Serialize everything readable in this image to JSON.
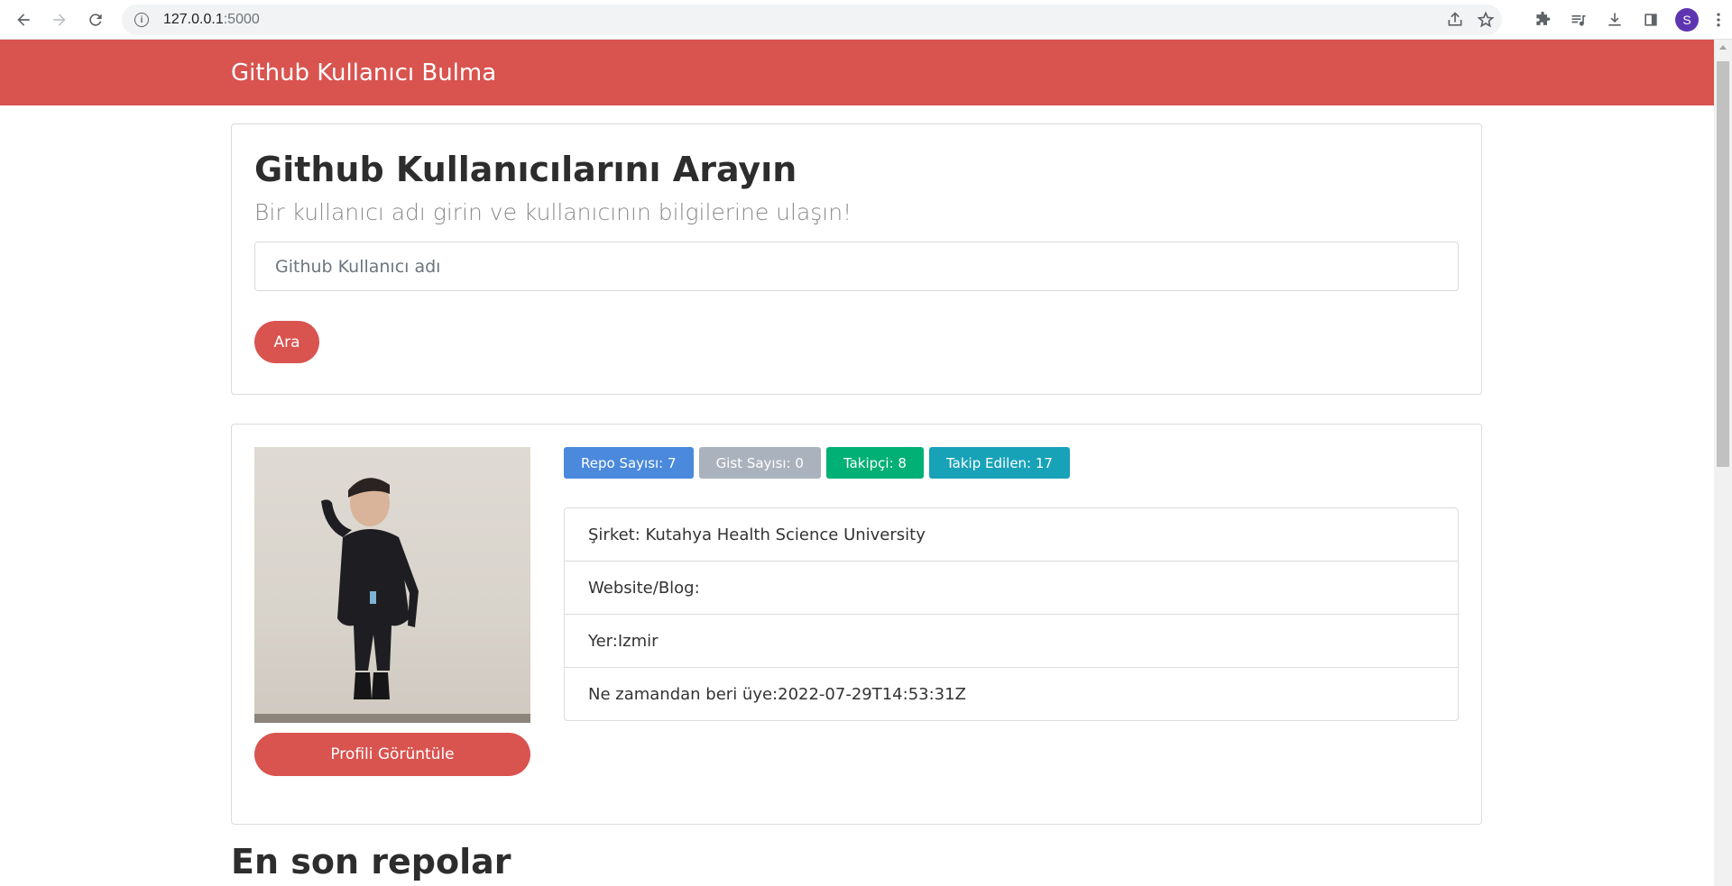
{
  "browser": {
    "url_host": "127.0.0.1",
    "url_port": ":5000",
    "profile_initial": "S"
  },
  "navbar": {
    "brand": "Github Kullanıcı Bulma"
  },
  "search": {
    "title": "Github Kullanıcılarını Arayın",
    "lead": "Bir kullanıcı adı girin ve kullanıcının bilgilerine ulaşın!",
    "input_value": "",
    "input_placeholder": "Github Kullanıcı adı",
    "button_label": "Ara"
  },
  "profile": {
    "badges": [
      {
        "label": "Repo Sayısı: 7",
        "color": "#4a89dc"
      },
      {
        "label": "Gist Sayısı: 0",
        "color": "#aab2bd"
      },
      {
        "label": "Takipçi: 8",
        "color": "#00b074"
      },
      {
        "label": "Takip Edilen: 17",
        "color": "#17a2b8"
      }
    ],
    "details": [
      "Şirket: Kutahya Health Science University",
      "Website/Blog:",
      "Yer:Izmir",
      "Ne zamandan beri üye:2022-07-29T14:53:31Z"
    ],
    "view_profile_label": "Profili Görüntüle"
  },
  "repos": {
    "title": "En son repolar"
  },
  "colors": {
    "brand_red": "#d9534f"
  }
}
